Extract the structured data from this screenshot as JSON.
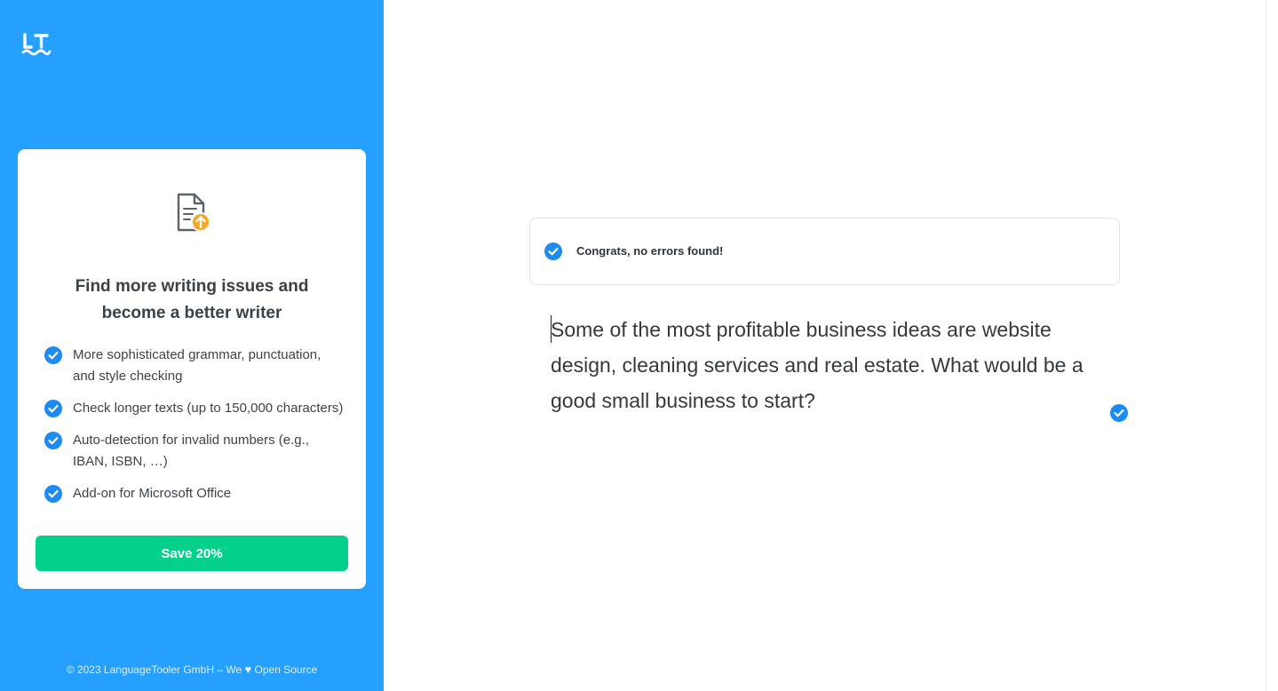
{
  "sidebar": {
    "logo_icon": "languagetool-logo-icon",
    "promo": {
      "icon": "document-upgrade-icon",
      "title_line1": "Find more writing issues and",
      "title_line2": "become a better writer",
      "features": [
        {
          "line1": "More sophisticated grammar, punctuation,",
          "line2": "and style checking"
        },
        {
          "line1": "Check longer texts (up to 150,000 characters)",
          "line2": ""
        },
        {
          "line1": "Auto-detection for invalid numbers (e.g.,",
          "line2": "IBAN, ISBN, …)"
        },
        {
          "line1": "Add-on for Microsoft Office",
          "line2": ""
        }
      ],
      "button_label": "Save 20%"
    },
    "footer": {
      "before_heart": "© 2023 LanguageTooler GmbH – We",
      "after_heart": "Open Source"
    }
  },
  "main": {
    "status_message": "Congrats, no errors found!",
    "editor_text": "Some of the most profitable business ideas are website design, cleaning services and real estate. What would be a good small business to start?"
  },
  "colors": {
    "sidebar_bg": "#26a0fe",
    "accent_blue": "#1d8bf1",
    "cta_green": "#03d18b",
    "upgrade_orange": "#f5a623"
  }
}
